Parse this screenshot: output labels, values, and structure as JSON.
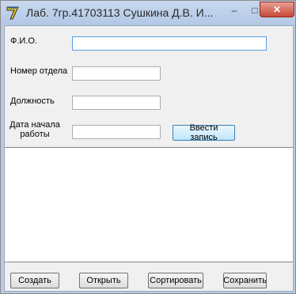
{
  "window": {
    "title": "Лаб. 7гр.41703113 Сушкина Д.В. И...",
    "minimize_glyph": "–",
    "maximize_glyph": "□",
    "close_glyph": "✕"
  },
  "form": {
    "fio_label": "Ф.И.О.",
    "department_label": "Номер отдела",
    "position_label": "Должность",
    "start_date_label": "Дата начала работы",
    "fio_value": "",
    "department_value": "",
    "position_value": "",
    "start_date_value": "",
    "enter_record_button": "Ввести запись"
  },
  "records": [],
  "bottom_buttons": {
    "create": "Создать",
    "open": "Открыть",
    "sort": "Сортировать",
    "save": "Сохранить"
  },
  "colors": {
    "titlebar": "#b8cbe5",
    "close_button": "#c8483a",
    "focus_border": "#569de5",
    "client_background": "#f0f0f0"
  },
  "icons": {
    "app": "app-icon-7"
  }
}
